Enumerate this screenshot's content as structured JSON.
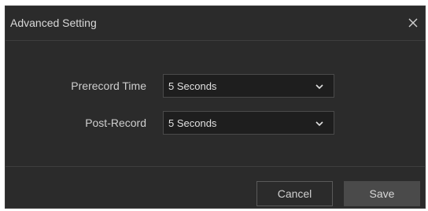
{
  "dialog": {
    "title": "Advanced Setting",
    "close_icon": "close-icon"
  },
  "fields": [
    {
      "label": "Prerecord Time",
      "value": "5 Seconds"
    },
    {
      "label": "Post-Record",
      "value": "5 Seconds"
    }
  ],
  "footer": {
    "cancel_label": "Cancel",
    "save_label": "Save"
  },
  "colors": {
    "dialog_bg": "#2b2b2b",
    "select_bg": "#1e1e1e",
    "save_bg": "#4a4a4a"
  }
}
